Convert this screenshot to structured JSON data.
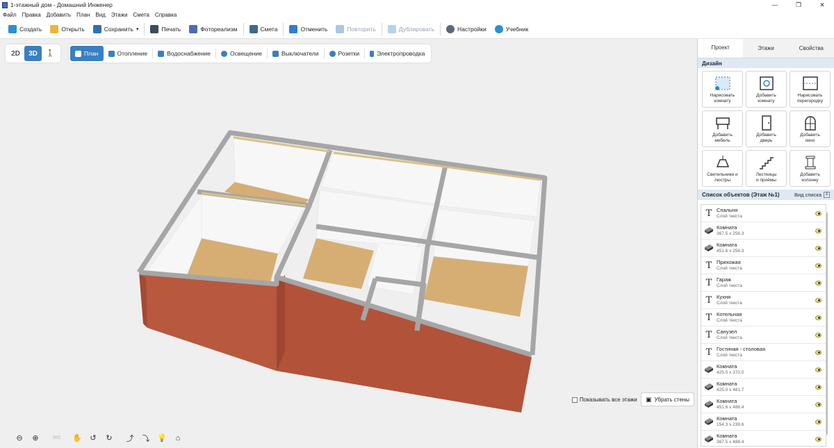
{
  "window": {
    "title": "1-этажный дом - Домашний Инженер",
    "min": "—",
    "max": "❐",
    "close": "✕"
  },
  "menu": [
    "Файл",
    "Правка",
    "Добавить",
    "План",
    "Вид",
    "Этажи",
    "Смета",
    "Справка"
  ],
  "toolbar": {
    "create": "Создать",
    "open": "Открыть",
    "save": "Сохранить",
    "save_caret": "▾",
    "print": "Печать",
    "photo": "Фотореализм",
    "estimate": "Смета",
    "undo": "Отменить",
    "redo": "Повторить",
    "duplicate": "Дублировать",
    "settings": "Настройки",
    "tutorial": "Учебник"
  },
  "viewmode": {
    "btn2d": "2D",
    "btn3d": "3D",
    "walk": "🚶"
  },
  "planbar": {
    "plan": "План",
    "heating": "Отопление",
    "water": "Водоснабжение",
    "lighting": "Освещение",
    "switches": "Выключатели",
    "sockets": "Розетки",
    "wiring": "Электропроводка"
  },
  "bottom": {
    "show_all_floors": "Показывать все этажи",
    "remove_walls": "Убрать стены",
    "rot360": "360"
  },
  "rpanel": {
    "tabs": [
      "Проект",
      "Этажи",
      "Свойства"
    ],
    "design_title": "Дизайн",
    "design": [
      "Нарисовать\nкомнату",
      "Добавить\nкомнату",
      "Нарисовать\nперегородку",
      "Добавить\nмебель",
      "Добавить\nдверь",
      "Добавить\nокно",
      "Светильники и\nлюстры",
      "Лестницы\nи проёмы",
      "Добавить\nколонну"
    ],
    "objlist_title": "Список объектов (Этаж №1)",
    "objlist_view": "Вид списка",
    "objects": [
      {
        "name": "Спальня",
        "sub": "Слой текста",
        "kind": "text"
      },
      {
        "name": "Комната",
        "sub": "367.5 x 256.3",
        "kind": "room"
      },
      {
        "name": "Комната",
        "sub": "451.6 x 256.3",
        "kind": "room"
      },
      {
        "name": "Прихожая",
        "sub": "Слой текста",
        "kind": "text"
      },
      {
        "name": "Гараж",
        "sub": "Слой текста",
        "kind": "text"
      },
      {
        "name": "Кухня",
        "sub": "Слой текста",
        "kind": "text"
      },
      {
        "name": "Котельная",
        "sub": "Слой текста",
        "kind": "text"
      },
      {
        "name": "Санузел",
        "sub": "Слой текста",
        "kind": "text"
      },
      {
        "name": "Гостиная - столовая",
        "sub": "Слой текста",
        "kind": "text"
      },
      {
        "name": "Комната",
        "sub": "425.0 x 370.0",
        "kind": "room"
      },
      {
        "name": "Комната",
        "sub": "425.0 x 481.7",
        "kind": "room"
      },
      {
        "name": "Комната",
        "sub": "451.6 x 488.4",
        "kind": "room"
      },
      {
        "name": "Комната",
        "sub": "154.3 x 239.6",
        "kind": "room"
      },
      {
        "name": "Комната",
        "sub": "367.5 x 488.4",
        "kind": "room"
      }
    ]
  },
  "colors": {
    "accent": "#3a7fc2",
    "brick": "#b8583f",
    "floor": "#d9b27a",
    "wall_top": "#a9a9a9"
  }
}
